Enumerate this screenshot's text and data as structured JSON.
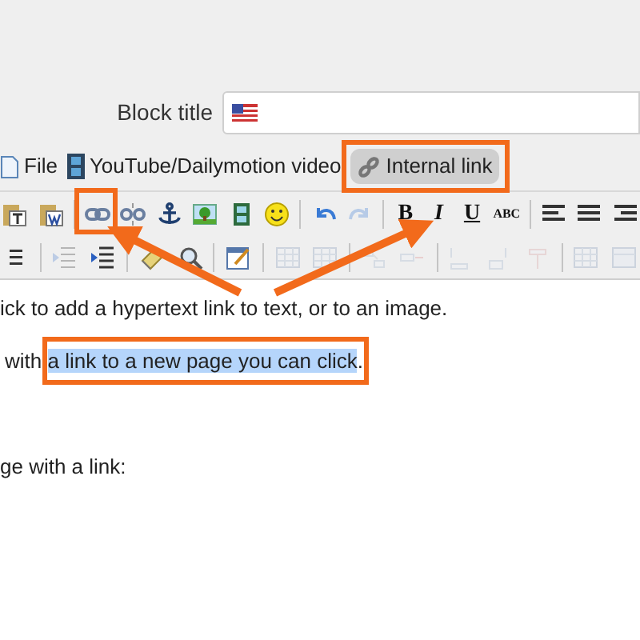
{
  "block_title": {
    "label": "Block title"
  },
  "tabs": [
    {
      "label": "File",
      "selected": false
    },
    {
      "label": "YouTube/Dailymotion video",
      "selected": false
    },
    {
      "label": "Internal link",
      "selected": true
    }
  ],
  "toolbar": {
    "rows": [
      [
        {
          "kind": "button",
          "disabled": false
        },
        {
          "kind": "button",
          "disabled": false
        },
        {
          "kind": "separator"
        },
        {
          "kind": "button",
          "disabled": false
        },
        {
          "kind": "button",
          "disabled": false
        },
        {
          "kind": "button",
          "disabled": false
        },
        {
          "kind": "button",
          "disabled": false
        },
        {
          "kind": "button",
          "disabled": false
        },
        {
          "kind": "button",
          "disabled": false
        },
        {
          "kind": "separator"
        },
        {
          "kind": "button",
          "disabled": false
        },
        {
          "kind": "button",
          "disabled": true
        },
        {
          "kind": "separator"
        },
        {
          "kind": "text",
          "label": "B",
          "disabled": false
        },
        {
          "kind": "text",
          "label": "I",
          "disabled": false
        },
        {
          "kind": "text",
          "label": "U",
          "disabled": false
        },
        {
          "kind": "text",
          "label": "ABC",
          "disabled": false
        },
        {
          "kind": "separator"
        },
        {
          "kind": "button",
          "disabled": false
        },
        {
          "kind": "button",
          "disabled": false
        },
        {
          "kind": "button",
          "disabled": false
        }
      ],
      [
        {
          "kind": "button",
          "disabled": false
        },
        {
          "kind": "separator"
        },
        {
          "kind": "button",
          "disabled": true
        },
        {
          "kind": "button",
          "disabled": false
        },
        {
          "kind": "separator"
        },
        {
          "kind": "button",
          "disabled": false
        },
        {
          "kind": "button",
          "disabled": false
        },
        {
          "kind": "separator"
        },
        {
          "kind": "button",
          "disabled": false
        },
        {
          "kind": "separator"
        },
        {
          "kind": "button",
          "disabled": true
        },
        {
          "kind": "button",
          "disabled": true
        },
        {
          "kind": "separator"
        },
        {
          "kind": "button",
          "disabled": true
        },
        {
          "kind": "button",
          "disabled": true
        },
        {
          "kind": "separator"
        },
        {
          "kind": "button",
          "disabled": true
        },
        {
          "kind": "button",
          "disabled": true
        },
        {
          "kind": "button",
          "disabled": true
        },
        {
          "kind": "separator"
        },
        {
          "kind": "button",
          "disabled": true
        },
        {
          "kind": "button",
          "disabled": true
        }
      ]
    ]
  },
  "editor": {
    "paragraphs": [
      [
        {
          "text": "ick to add a hypertext link to text, or to an image.",
          "selected": false
        }
      ],
      [
        {
          "text": "with ",
          "selected": false
        },
        {
          "text": "a link to a new page you can click",
          "selected": true
        },
        {
          "text": ".",
          "selected": false
        }
      ],
      [
        {
          "text": "ge with a link:",
          "selected": false
        }
      ]
    ]
  }
}
